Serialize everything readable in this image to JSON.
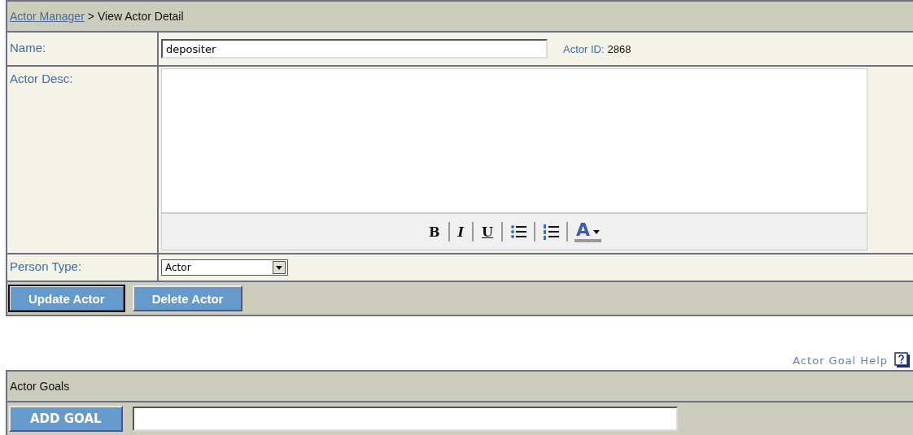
{
  "breadcrumb": {
    "link": "Actor Manager",
    "separator": ">",
    "current": "View Actor Detail"
  },
  "form": {
    "name_label": "Name:",
    "name_value": "depositer",
    "id_label": "Actor ID:",
    "id_value": "2868",
    "desc_label": "Actor Desc:",
    "toolbar": [
      {
        "kind": "bold",
        "label": "B"
      },
      {
        "kind": "italic",
        "label": "I"
      },
      {
        "kind": "underline",
        "label": "U"
      },
      {
        "kind": "bullets"
      },
      {
        "kind": "numbers"
      },
      {
        "kind": "color",
        "label": "A"
      }
    ],
    "type_label": "Person Type:",
    "type_value": "Actor"
  },
  "buttons": [
    {
      "label": "Update Actor",
      "focused": true
    },
    {
      "label": "Delete Actor",
      "focused": false
    }
  ],
  "help_link": "Actor Goal Help",
  "goals": {
    "title": "Actor Goals",
    "add_button": "ADD GOAL"
  }
}
